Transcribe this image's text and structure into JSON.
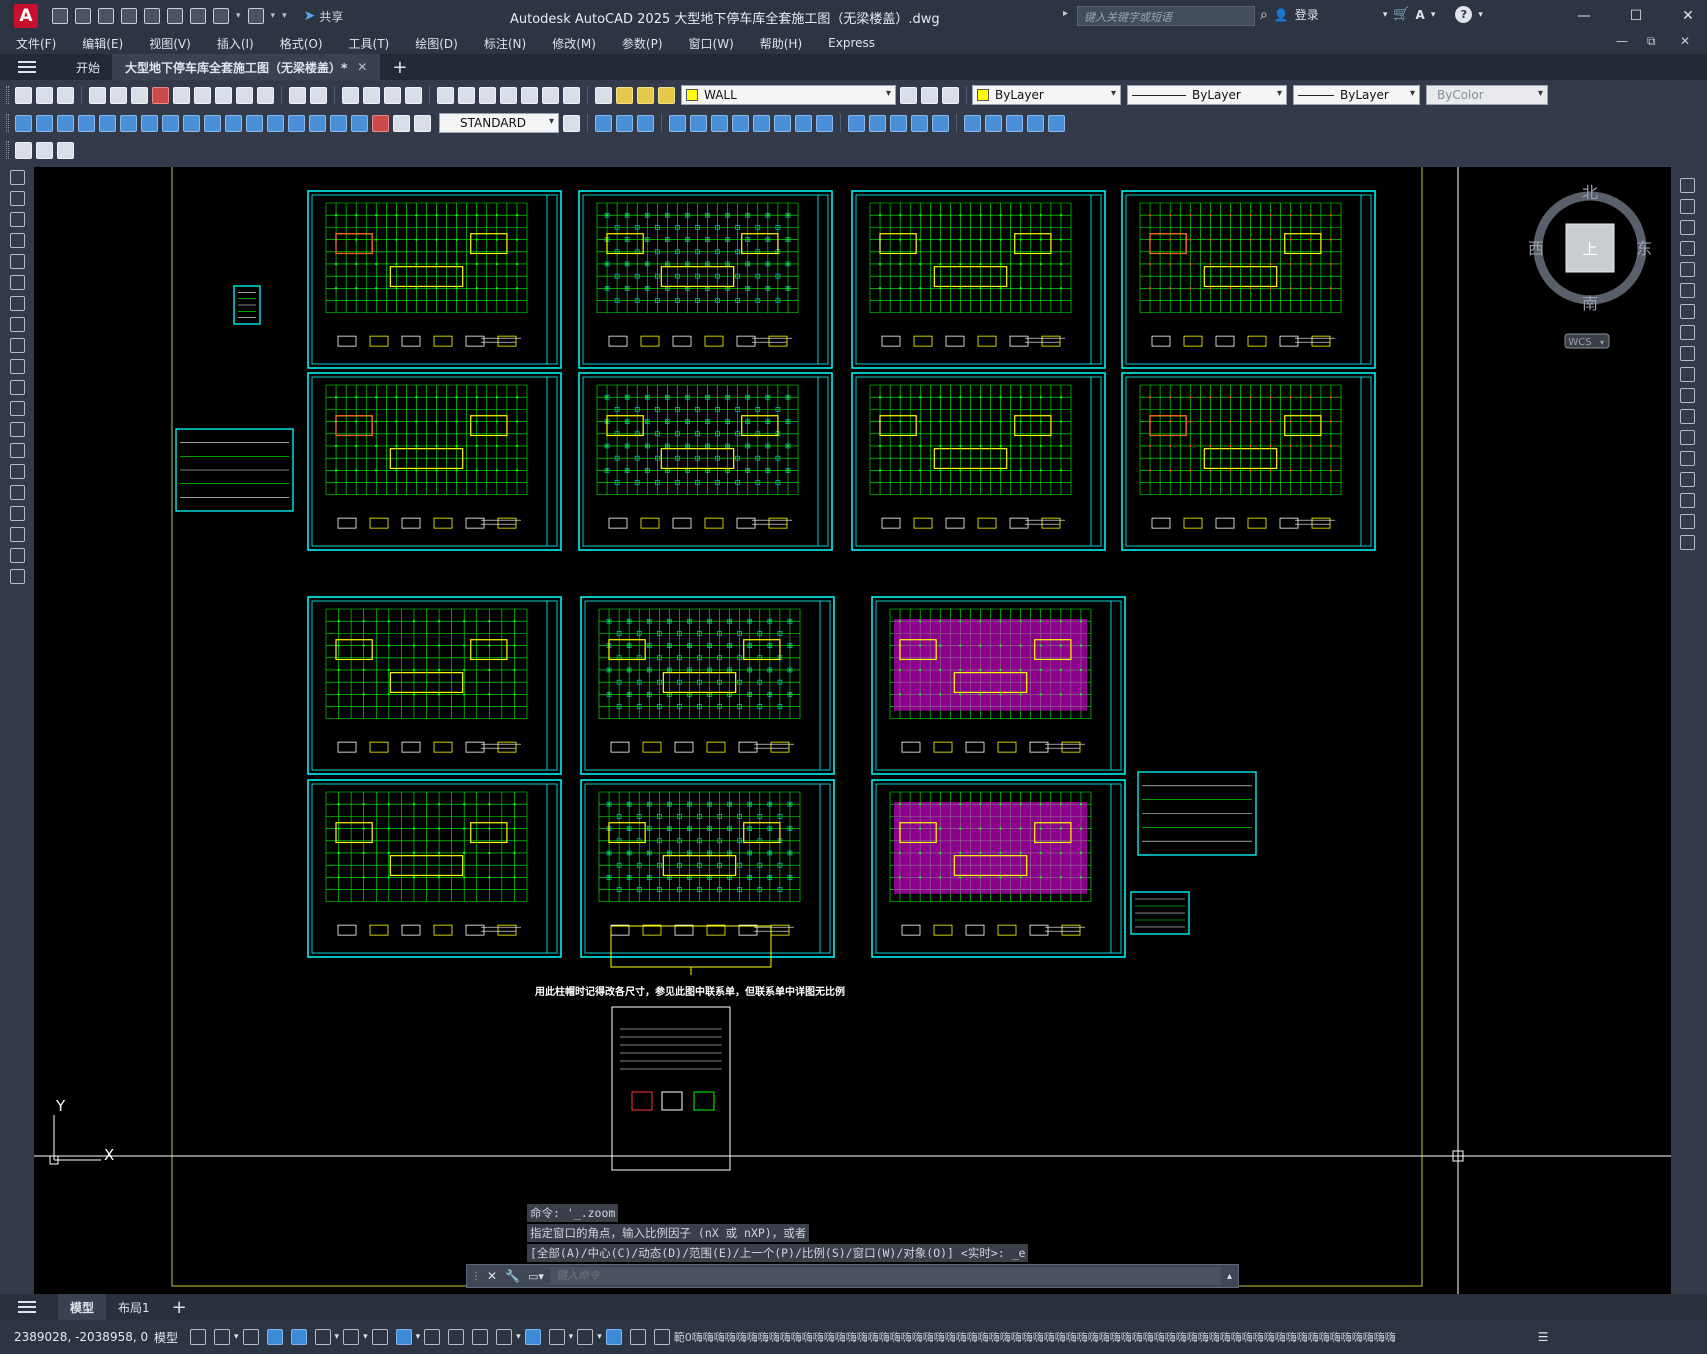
{
  "app": {
    "logo_letter": "A",
    "title": "Autodesk AutoCAD 2025    大型地下停车库全套施工图（无梁楼盖）.dwg",
    "share_label": "共享",
    "search_placeholder": "键入关键字或短语",
    "login_label": "登录",
    "help_label": "?"
  },
  "window_controls": {
    "minimize": "—",
    "maximize": "☐",
    "close": "✕"
  },
  "mdi_controls": {
    "minimize": "—",
    "restore": "⧉",
    "close": "✕"
  },
  "menu": [
    "文件(F)",
    "编辑(E)",
    "视图(V)",
    "插入(I)",
    "格式(O)",
    "工具(T)",
    "绘图(D)",
    "标注(N)",
    "修改(M)",
    "参数(P)",
    "窗口(W)",
    "帮助(H)",
    "Express"
  ],
  "tabs": {
    "start_label": "开始",
    "document_label": "大型地下停车库全套施工图（无梁楼盖）*",
    "close_glyph": "✕",
    "new_tab_glyph": "+"
  },
  "properties": {
    "layer": "WALL",
    "color": "ByLayer",
    "linetype": "ByLayer",
    "lineweight": "ByLayer",
    "plotstyle": "ByColor",
    "text_style": "STANDARD"
  },
  "viewcube": {
    "north": "北",
    "south": "南",
    "east": "东",
    "west": "西",
    "top": "上",
    "wcs": "WCS"
  },
  "ucs": {
    "y": "Y",
    "x": "X"
  },
  "drawing": {
    "note": "用此柱帽时记得改各尺寸，参见此图中联系单，但联系单中详图无比例"
  },
  "command": {
    "history": [
      "命令: '_.zoom",
      "指定窗口的角点，输入比例因子 (nX 或 nXP)，或者",
      "[全部(A)/中心(C)/动态(D)/范围(E)/上一个(P)/比例(S)/窗口(W)/对象(O)] <实时>: _e"
    ],
    "placeholder": "键入命令"
  },
  "layout_tabs": {
    "model": "模型",
    "layout1": "布局1",
    "add": "+"
  },
  "status": {
    "coordinates": "2389028, -2038958, 0",
    "model_label": "模型",
    "garbled_text": "範0嗨嗨嗨嗨嗨嗨嗨嗨嗨嗨嗨嗨嗨嗨嗨嗨嗨嗨嗨嗨嗨嗨嗨嗨嗨嗨嗨嗨嗨嗨嗨嗨嗨嗨嗨嗨嗨嗨嗨嗨嗨嗨嗨嗨嗨嗨嗨嗨嗨嗨嗨嗨嗨嗨嗨嗨嗨嗨嗨嗨嗨嗨嗨嗨"
  },
  "colors": {
    "canvas": "#000000",
    "sheet_border": "#00ffff",
    "grid_lines": "#00ff00",
    "outline": "#ffff00",
    "columns": "#ff3030",
    "slab": "#ff00ff",
    "accent": "#3d8ad6"
  }
}
